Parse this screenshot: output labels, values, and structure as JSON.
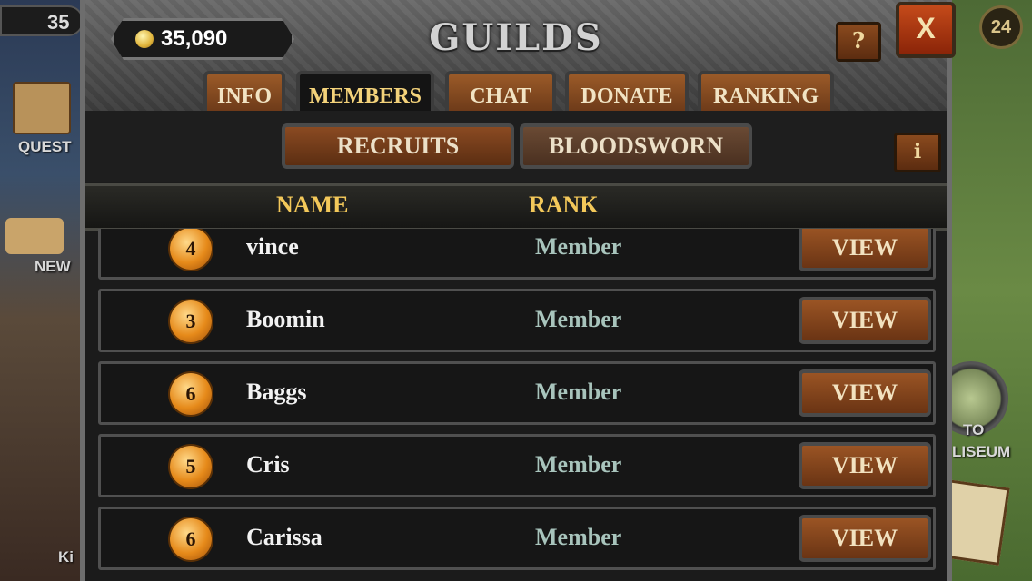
{
  "hud": {
    "gold_partial": "35",
    "level": "24",
    "side_labels": {
      "quests": "QUEST",
      "news": "NEW",
      "colosseum_1": "TO",
      "colosseum_2": "LISEUM",
      "bottom": "Ki"
    }
  },
  "header": {
    "title": "GUILDS",
    "gold": "35,090",
    "help_label": "?",
    "close_label": "X"
  },
  "tabs": [
    {
      "label": "INFO",
      "active": false
    },
    {
      "label": "MEMBERS",
      "active": true
    },
    {
      "label": "CHAT",
      "active": false
    },
    {
      "label": "DONATE",
      "active": false
    },
    {
      "label": "RANKING",
      "active": false
    }
  ],
  "subtabs": {
    "recruits": "RECRUITS",
    "bloodsworn": "BLOODSWORN",
    "info_label": "i"
  },
  "columns": {
    "name": "NAME",
    "rank": "RANK"
  },
  "members": [
    {
      "level": "4",
      "name": "vince",
      "rank": "Member",
      "action": "VIEW"
    },
    {
      "level": "3",
      "name": "Boomin",
      "rank": "Member",
      "action": "VIEW"
    },
    {
      "level": "6",
      "name": "Baggs",
      "rank": "Member",
      "action": "VIEW"
    },
    {
      "level": "5",
      "name": "Cris",
      "rank": "Member",
      "action": "VIEW"
    },
    {
      "level": "6",
      "name": "Carissa",
      "rank": "Member",
      "action": "VIEW"
    }
  ],
  "colors": {
    "accent": "#f3c85a",
    "button": "#8a4a22",
    "rank_text": "#a8c4bc"
  }
}
